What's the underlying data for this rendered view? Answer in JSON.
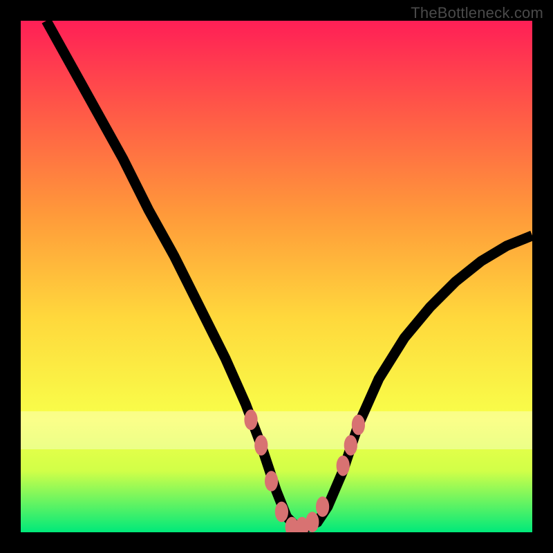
{
  "watermark": "TheBottleneck.com",
  "colors": {
    "frame": "#000000",
    "marker": "#d87272",
    "curve": "#000000",
    "gradient_top": "#ff1f56",
    "gradient_bottom": "#00e97a"
  },
  "chart_data": {
    "type": "line",
    "title": "",
    "xlabel": "",
    "ylabel": "",
    "xlim": [
      0,
      100
    ],
    "ylim": [
      0,
      100
    ],
    "grid": false,
    "legend": false,
    "series": [
      {
        "name": "bottleneck-curve",
        "x": [
          5,
          10,
          15,
          20,
          25,
          30,
          35,
          40,
          44,
          47,
          50,
          52,
          54,
          56,
          58,
          60,
          63,
          66,
          70,
          75,
          80,
          85,
          90,
          95,
          100
        ],
        "y": [
          100,
          91,
          82,
          73,
          63,
          54,
          44,
          34,
          25,
          17,
          8,
          3,
          1,
          1,
          2,
          5,
          12,
          21,
          30,
          38,
          44,
          49,
          53,
          56,
          58
        ]
      }
    ],
    "markers": {
      "name": "highlighted-points",
      "x": [
        45,
        47,
        49,
        51,
        53,
        55,
        57,
        59,
        63,
        64.5,
        66
      ],
      "y": [
        22,
        17,
        10,
        4,
        1,
        1,
        2,
        5,
        13,
        17,
        21
      ]
    },
    "annotations": [
      {
        "type": "horizontal-band",
        "y_range": [
          16,
          23
        ],
        "style": "pale"
      }
    ]
  }
}
